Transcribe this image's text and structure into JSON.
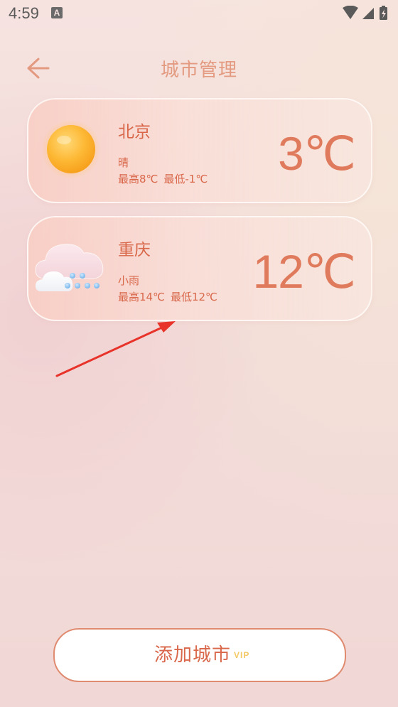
{
  "status_bar": {
    "time": "4:59",
    "notification_icon": "a-letter-icon",
    "notification_letter": "A",
    "icons": [
      "wifi-icon",
      "signal-icon",
      "battery-charging-icon"
    ]
  },
  "header": {
    "title": "城市管理",
    "back_icon": "arrow-left-icon"
  },
  "cities": [
    {
      "name": "北京",
      "weather": "晴",
      "high": "最高8℃",
      "low": "最低-1℃",
      "temp": "3℃",
      "icon": "sun-icon"
    },
    {
      "name": "重庆",
      "weather": "小雨",
      "high": "最高14℃",
      "low": "最低12℃",
      "temp": "12℃",
      "icon": "cloud-rain-icon"
    }
  ],
  "add_button": {
    "label": "添加城市",
    "badge": "VIP"
  },
  "colors": {
    "accent": "#d9674a",
    "title": "#e39a80",
    "arrow": "#e8332a",
    "vip": "#f3c865"
  }
}
